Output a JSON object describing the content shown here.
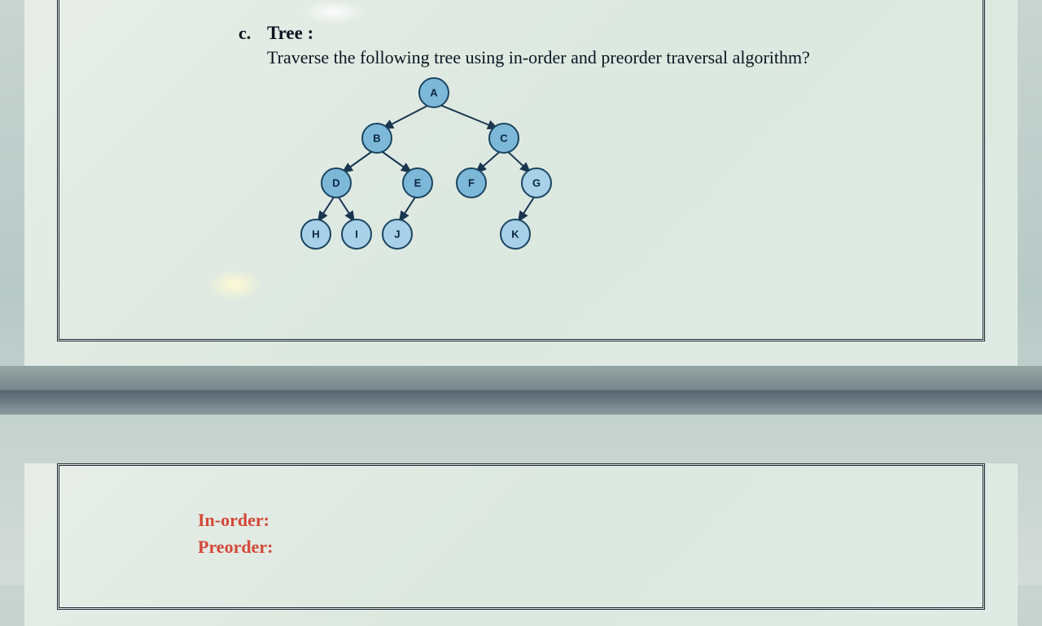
{
  "question": {
    "label": "c.",
    "title": "Tree :",
    "text": "Traverse the following tree using in-order and preorder traversal algorithm?"
  },
  "tree": {
    "nodes": {
      "A": "A",
      "B": "B",
      "C": "C",
      "D": "D",
      "E": "E",
      "F": "F",
      "G": "G",
      "H": "H",
      "I": "I",
      "J": "J",
      "K": "K"
    }
  },
  "answers": {
    "inorder_label": "In-order:",
    "preorder_label": "Preorder:"
  }
}
